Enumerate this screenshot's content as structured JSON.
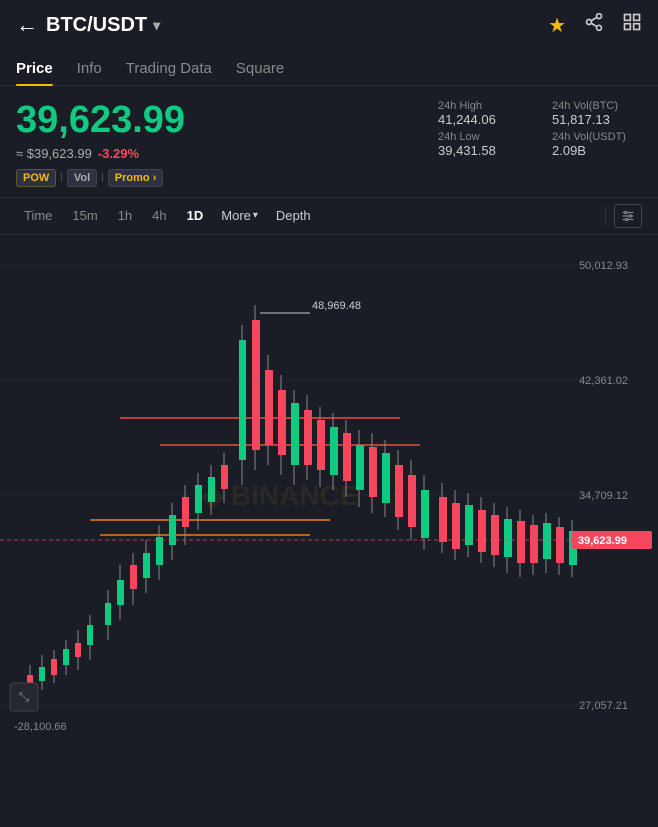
{
  "header": {
    "back_icon": "←",
    "title": "BTC/USDT",
    "chevron": "▾",
    "star_icon": "★",
    "share_icon": "◄",
    "grid_icon": "⊞"
  },
  "tabs": [
    {
      "label": "Price",
      "active": true
    },
    {
      "label": "Info",
      "active": false
    },
    {
      "label": "Trading Data",
      "active": false
    },
    {
      "label": "Square",
      "active": false
    }
  ],
  "price": {
    "main": "39,623.99",
    "usd": "≈ $39,623.99",
    "change": "-3.29%",
    "tags": [
      "POW",
      "Vol",
      "Promo"
    ],
    "stats": {
      "high_label": "24h High",
      "high_value": "41,244.06",
      "vol_btc_label": "24h Vol(BTC)",
      "vol_btc_value": "51,817.13",
      "low_label": "24h Low",
      "low_value": "39,431.58",
      "vol_usdt_label": "24h Vol(USDT)",
      "vol_usdt_value": "2.09B"
    }
  },
  "toolbar": {
    "items": [
      {
        "label": "Time",
        "active": false
      },
      {
        "label": "15m",
        "active": false
      },
      {
        "label": "1h",
        "active": false
      },
      {
        "label": "4h",
        "active": false
      },
      {
        "label": "1D",
        "active": true
      },
      {
        "label": "More",
        "active": false
      },
      {
        "label": "Depth",
        "active": false
      }
    ]
  },
  "chart": {
    "y_labels": [
      "50,012.93",
      "42,361.02",
      "34,709.12",
      "27,057.21"
    ],
    "current_price": "39,623.99",
    "annotation_high": "48,969.48",
    "bottom_label": "-28,100.66",
    "watermark": "BINANCE"
  }
}
